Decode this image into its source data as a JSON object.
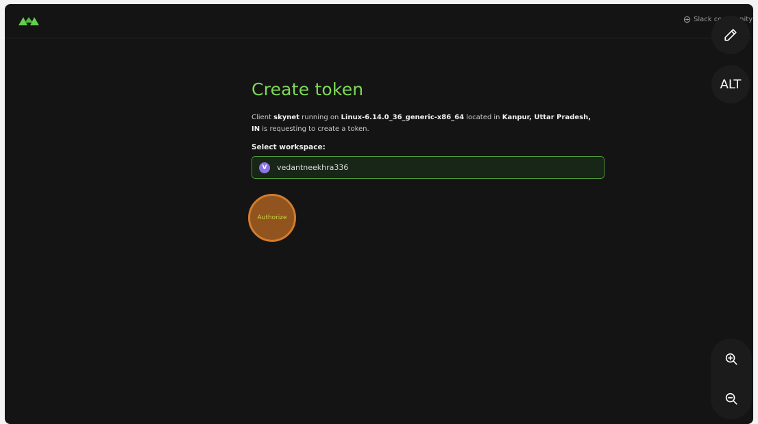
{
  "header": {
    "community_link": "Slack community"
  },
  "main": {
    "title": "Create token",
    "description": {
      "prefix": "Client ",
      "client_name": "skynet",
      "running_on": " running on ",
      "platform": "Linux-6.14.0_36_generic-x86_64",
      "located_in": " located in ",
      "location": "Kanpur, Uttar Pradesh, IN",
      "suffix": " is requesting to create a token."
    },
    "workspace_label": "Select workspace:",
    "workspace": {
      "avatar_letter": "V",
      "name": "vedantneekhra336"
    },
    "authorize_label": "Authorize"
  },
  "tools": {
    "alt_label": "ALT"
  },
  "colors": {
    "accent_green": "#7ed957",
    "highlight_orange": "#d47c2c",
    "background": "#141414"
  }
}
